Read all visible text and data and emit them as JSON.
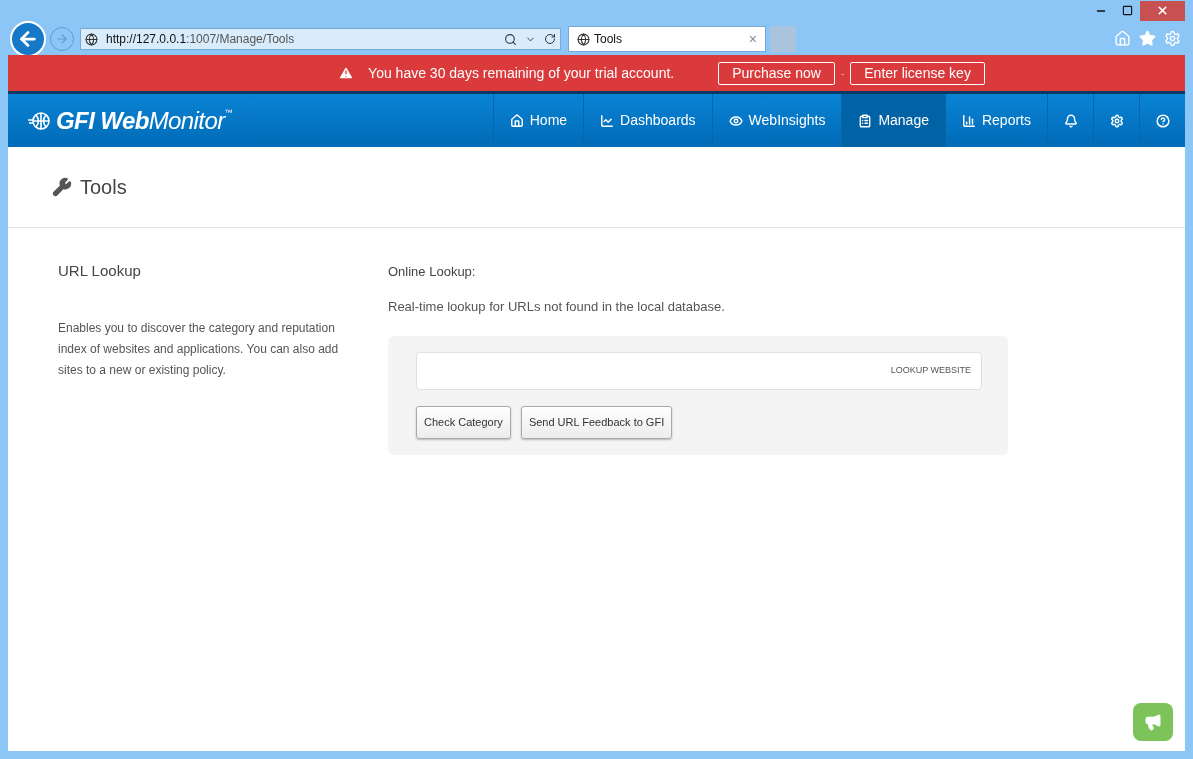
{
  "browser": {
    "address": {
      "host": "http://127.0.0.1",
      "path": ":1007/Manage/Tools"
    },
    "tab": {
      "title": "Tools",
      "close": "×"
    }
  },
  "trial_banner": {
    "message": "You have 30 days remaining of your trial account.",
    "buttons": [
      "Purchase now",
      "Enter license key"
    ],
    "separator": "-"
  },
  "logo": {
    "bold": "GFI Web",
    "light": "Monitor",
    "mark": "™"
  },
  "nav": [
    {
      "kind": "home",
      "label": "Home",
      "selected": false
    },
    {
      "kind": "dashboards",
      "label": "Dashboards",
      "selected": false
    },
    {
      "kind": "insights",
      "label": "WebInsights",
      "selected": false
    },
    {
      "kind": "manage",
      "label": "Manage",
      "selected": true
    },
    {
      "kind": "reports",
      "label": "Reports",
      "selected": false
    },
    {
      "kind": "alerts",
      "selected": false
    },
    {
      "kind": "settings",
      "selected": false
    },
    {
      "kind": "help",
      "selected": false
    }
  ],
  "page": {
    "title": "Tools"
  },
  "section": {
    "title": "URL Lookup",
    "description": "Enables you to discover the category and reputation index of websites and applications. You can also add sites to a new or existing policy."
  },
  "online_lookup": {
    "heading": "Online Lookup:",
    "description": "Real-time lookup for URLs not found in the local database.",
    "field_action": "LOOKUP WEBSITE",
    "buttons": [
      "Check Category",
      "Send URL Feedback to GFI"
    ]
  }
}
